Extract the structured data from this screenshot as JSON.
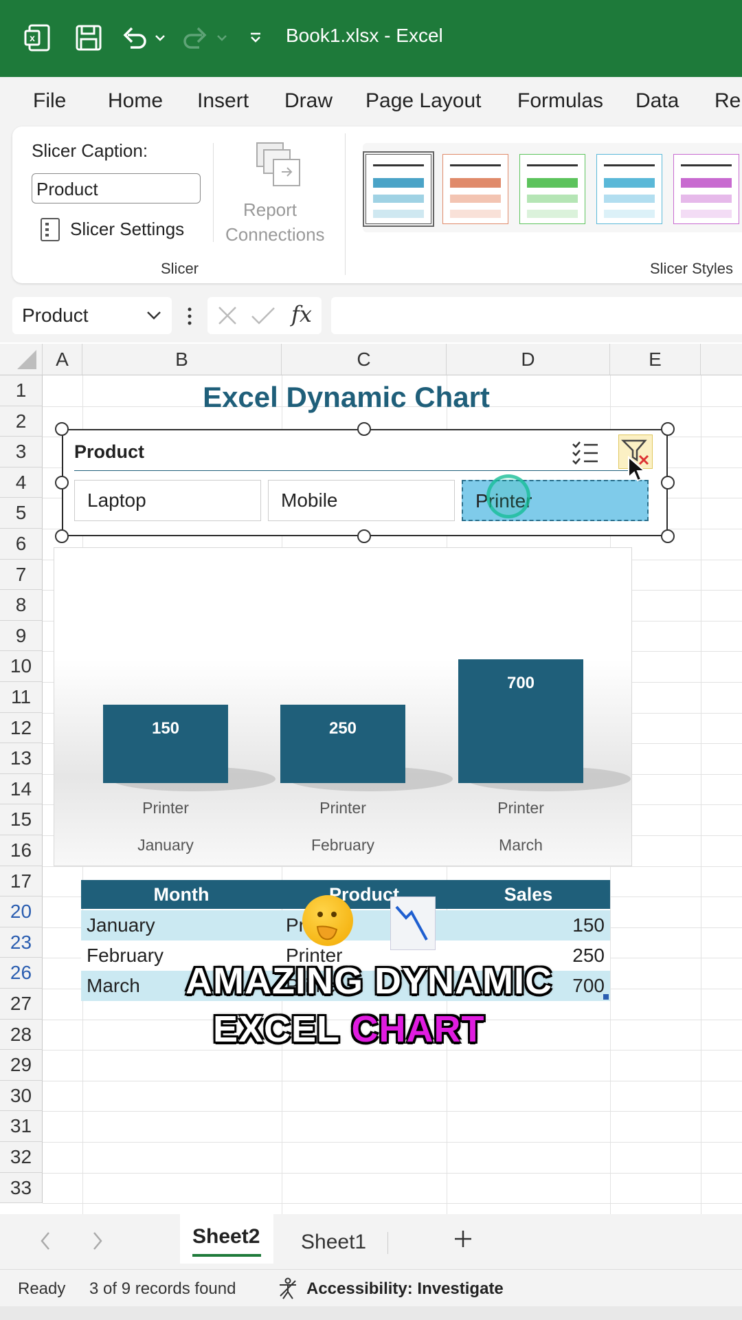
{
  "title_bar": {
    "title": "Book1.xlsx  -  Excel",
    "icons": [
      "excel-logo-icon",
      "save-icon",
      "undo-icon",
      "redo-icon",
      "customize-toolbar-icon"
    ]
  },
  "ribbon_tabs": [
    "File",
    "Home",
    "Insert",
    "Draw",
    "Page Layout",
    "Formulas",
    "Data",
    "Re"
  ],
  "ribbon": {
    "slicer_caption_label": "Slicer Caption:",
    "slicer_caption_value": "Product",
    "slicer_settings_label": "Slicer Settings",
    "report_connections_line1": "Report",
    "report_connections_line2": "Connections",
    "slicer_group": "Slicer",
    "slicer_styles_group": "Slicer Styles",
    "style_colors": [
      "#4aa3c7",
      "#e08a6a",
      "#5cc35c",
      "#5ab8d8",
      "#c86ad0"
    ]
  },
  "formula_bar": {
    "name_box": "Product",
    "fx": "fx",
    "formula": ""
  },
  "columns": [
    "A",
    "B",
    "C",
    "D",
    "E"
  ],
  "rows": [
    "1",
    "2",
    "3",
    "4",
    "5",
    "6",
    "7",
    "8",
    "9",
    "10",
    "11",
    "12",
    "13",
    "14",
    "15",
    "16",
    "17",
    "20",
    "23",
    "26",
    "27",
    "28",
    "29",
    "30",
    "31",
    "32",
    "33"
  ],
  "sheet_title": "Excel Dynamic Chart",
  "slicer": {
    "header": "Product",
    "items": [
      "Laptop",
      "Mobile",
      "Printer"
    ],
    "selected": "Printer"
  },
  "chart_data": {
    "type": "bar",
    "categories": [
      "Printer January",
      "Printer February",
      "Printer March"
    ],
    "category_line1": [
      "Printer",
      "Printer",
      "Printer"
    ],
    "category_line2": [
      "January",
      "February",
      "March"
    ],
    "values": [
      150,
      250,
      700
    ],
    "data_labels": [
      "150",
      "250",
      "700"
    ],
    "bar_color": "#1f5f7a",
    "title": "",
    "xlabel": "",
    "ylabel": ""
  },
  "table": {
    "headers": [
      "Month",
      "Product",
      "Sales"
    ],
    "rows": [
      {
        "month": "January",
        "product": "Printer",
        "sales": "150"
      },
      {
        "month": "February",
        "product": "Printer",
        "sales": "250"
      },
      {
        "month": "March",
        "product": "Printer",
        "sales": "700"
      }
    ],
    "header_color": "#1f5f7a",
    "band_color": "#cbe9f2"
  },
  "overlay_caption": {
    "line1": "AMAZING DYNAMIC",
    "line2_white": "EXCEL",
    "line2_pink": "CHART",
    "pink": "#e01ce0"
  },
  "sheets": [
    "Sheet2",
    "Sheet1"
  ],
  "active_sheet": "Sheet2",
  "status": {
    "ready": "Ready",
    "records": "3 of 9 records found",
    "accessibility": "Accessibility: Investigate"
  }
}
